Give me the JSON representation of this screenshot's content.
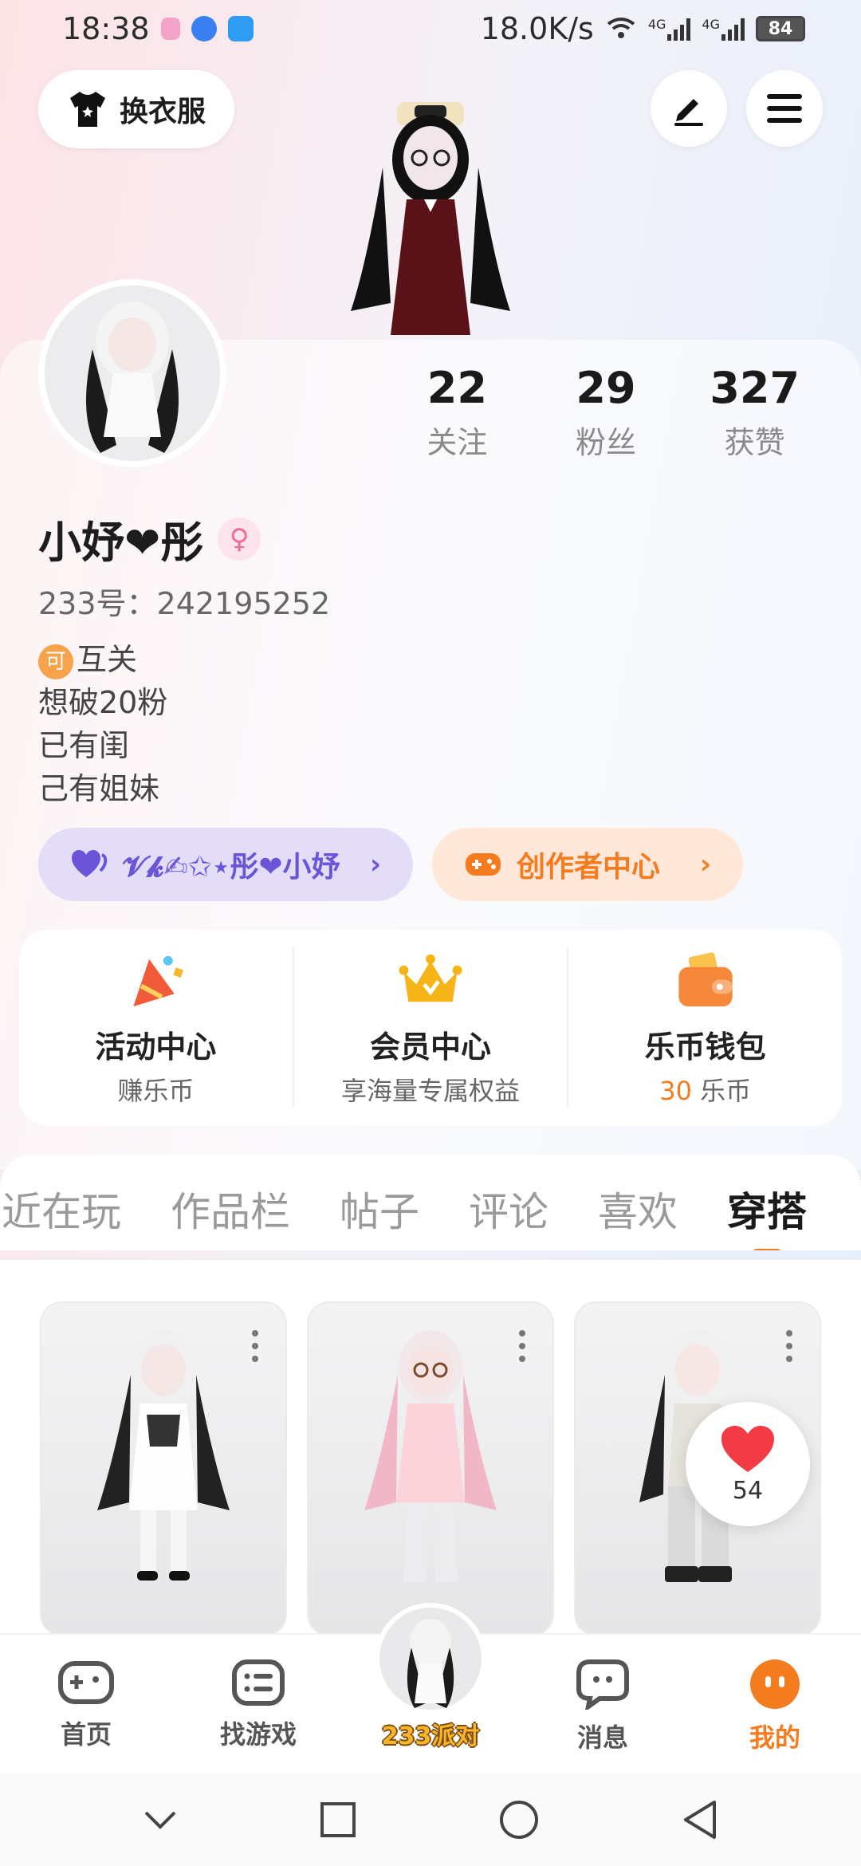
{
  "status_bar": {
    "time": "18:38",
    "net_speed": "18.0K/s",
    "net_type_1": "4G",
    "net_type_2": "4G",
    "battery": "84"
  },
  "header": {
    "outfit_button_label": "换衣服",
    "edit_icon": "pen-icon",
    "menu_icon": "hamburger-icon"
  },
  "profile": {
    "nickname": "小妤❤彤",
    "gender_symbol": "♀",
    "uid_label": "233号：",
    "uid": "242195252",
    "bio_badge": "可",
    "bio_lines": [
      "互关",
      "想破20粉",
      "已有闺",
      "己有姐妹"
    ]
  },
  "stats": [
    {
      "value": "22",
      "label": "关注"
    },
    {
      "value": "29",
      "label": "粉丝"
    },
    {
      "value": "327",
      "label": "获赞"
    }
  ],
  "pills": {
    "friend_label": "𝓥𝓴✍✩⋆彤❤小妤",
    "creator_label": "创作者中心",
    "chevron": "›"
  },
  "quick_entries": [
    {
      "title": "活动中心",
      "subtitle": "赚乐币",
      "icon": "party-hat-icon"
    },
    {
      "title": "会员中心",
      "subtitle": "享海量专属权益",
      "icon": "crown-icon"
    },
    {
      "title": "乐币钱包",
      "subtitle_num": "30",
      "subtitle_unit": "乐币",
      "icon": "wallet-icon"
    }
  ],
  "tabs": [
    "最近在玩",
    "作品栏",
    "帖子",
    "评论",
    "喜欢",
    "穿搭"
  ],
  "active_tab": "穿搭",
  "like_bubble": {
    "count": "54"
  },
  "bottom_nav": {
    "home": "首页",
    "find_games": "找游戏",
    "center": "233派对",
    "messages": "消息",
    "mine": "我的"
  },
  "colors": {
    "accent": "#f47b1e",
    "friend_purple": "#6b54d8",
    "like_red": "#f23b45"
  }
}
